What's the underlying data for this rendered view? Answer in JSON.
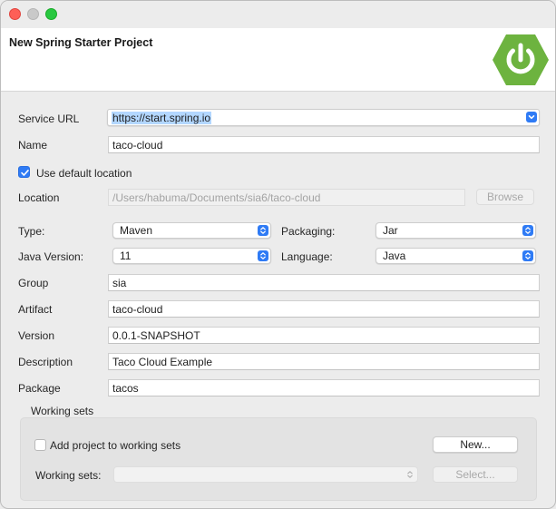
{
  "banner": {
    "title": "New Spring Starter Project",
    "logo_icon": "spring-power-icon",
    "logo_color": "#6db33f"
  },
  "form": {
    "service_url": {
      "label": "Service URL",
      "value": "https://start.spring.io"
    },
    "name": {
      "label": "Name",
      "value": "taco-cloud"
    },
    "use_default_location": {
      "label": "Use default location",
      "checked": true
    },
    "location": {
      "label": "Location",
      "value": "/Users/habuma/Documents/sia6/taco-cloud",
      "browse_label": "Browse"
    },
    "type": {
      "label": "Type:",
      "value": "Maven"
    },
    "packaging": {
      "label": "Packaging:",
      "value": "Jar"
    },
    "java_version": {
      "label": "Java Version:",
      "value": "11"
    },
    "language": {
      "label": "Language:",
      "value": "Java"
    },
    "group": {
      "label": "Group",
      "value": "sia"
    },
    "artifact": {
      "label": "Artifact",
      "value": "taco-cloud"
    },
    "version": {
      "label": "Version",
      "value": "0.0.1-SNAPSHOT"
    },
    "description": {
      "label": "Description",
      "value": "Taco Cloud Example"
    },
    "package": {
      "label": "Package",
      "value": "tacos"
    }
  },
  "working_sets": {
    "title": "Working sets",
    "add_label": "Add project to working sets",
    "add_checked": false,
    "new_button": "New...",
    "sets_label": "Working sets:",
    "sets_value": "",
    "select_button": "Select..."
  },
  "colors": {
    "accent": "#2f7bf5",
    "close": "#fe5f57",
    "minimize": "#c9c9c9",
    "maximize": "#28c840"
  }
}
